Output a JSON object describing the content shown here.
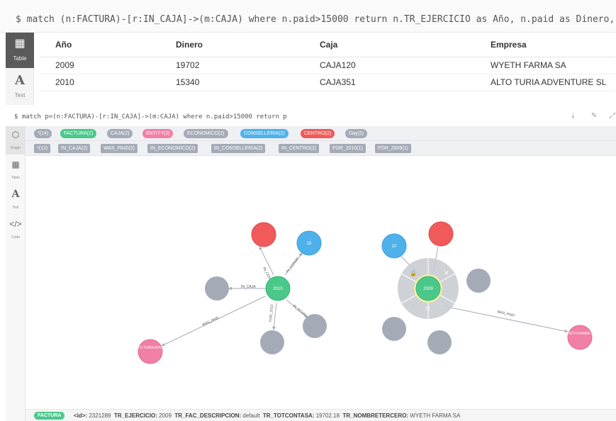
{
  "query1": "$ match (n:FACTURA)-[r:IN_CAJA]->(m:CAJA) where n.paid>15000 return n.TR_EJERCICIO as Año, n.paid as Dinero, m.CODCF as Caja,",
  "nav1": {
    "table": "Table",
    "text": "Text"
  },
  "table": {
    "headers": [
      "Año",
      "Dinero",
      "Caja",
      "Empresa"
    ],
    "rows": [
      [
        "2009",
        "19702",
        "CAJA120",
        "WYETH FARMA SA"
      ],
      [
        "2010",
        "15340",
        "CAJA351",
        "ALTO TURIA ADVENTURE SL"
      ]
    ]
  },
  "query2": "$ match p=(n:FACTURA)-[r:IN_CAJA]->(m:CAJA) where n.paid>15000 return p",
  "nav2": {
    "graph": "Graph",
    "table": "Table",
    "text": "Text",
    "code": "Code"
  },
  "node_labels": [
    {
      "label": "*(14)",
      "color": "#a5abb6"
    },
    {
      "label": "FACTURA(2)",
      "color": "#4ac88a"
    },
    {
      "label": "CAJA(2)",
      "color": "#a5abb6"
    },
    {
      "label": "ENTITY(2)",
      "color": "#f27fa6"
    },
    {
      "label": "ECONOMICO(2)",
      "color": "#a5abb6"
    },
    {
      "label": "CONSELLERIA(2)",
      "color": "#4fb1ea"
    },
    {
      "label": "CENTRO(2)",
      "color": "#f05a5a"
    },
    {
      "label": "Day(2)",
      "color": "#a5abb6"
    }
  ],
  "rel_types": [
    "*(12)",
    "IN_CAJA(2)",
    "WAS_PAID(2)",
    "IN_ECONOMICO(2)",
    "IN_CONSELLERIA(2)",
    "IN_CENTRO(2)",
    "FOR_2010(1)",
    "FOR_2009(1)"
  ],
  "graph": {
    "node_text": {
      "f1": "2010",
      "f2": "2009",
      "c1": "15",
      "c2": "10",
      "e1": "ALTO TURIA ADVE...",
      "e2": "WYETH FARMA SA"
    },
    "rel_text": {
      "in_caja": "IN_CAJA",
      "in_centro": "IN_CENTRO",
      "in_conse": "IN_CONSE...",
      "in_econ": "IN_ECON...",
      "for2010": "FOR_2010",
      "was_paid1": "WAS_PAID",
      "was_paid2": "WAS_PAID",
      "ring1": "IN..",
      "ring2": "IN..",
      "ring3": "IC.",
      "ring4": "IO"
    }
  },
  "footer": {
    "label": "FACTURA",
    "props": [
      {
        "key": "<id>:",
        "value": "2321289"
      },
      {
        "key": "TR_EJERCICIO:",
        "value": "2009"
      },
      {
        "key": "TR_FAC_DESCRIPCION:",
        "value": "default"
      },
      {
        "key": "TR_TOTCONTASA:",
        "value": "19702.18"
      },
      {
        "key": "TR_NOMBRETERCERO:",
        "value": "WYETH FARMA SA"
      }
    ]
  },
  "colors": {
    "factura": "#4ac88a",
    "caja": "#a5abb6",
    "entity": "#f27fa6",
    "conselleria": "#4fb1ea",
    "centro": "#f05a5a"
  }
}
